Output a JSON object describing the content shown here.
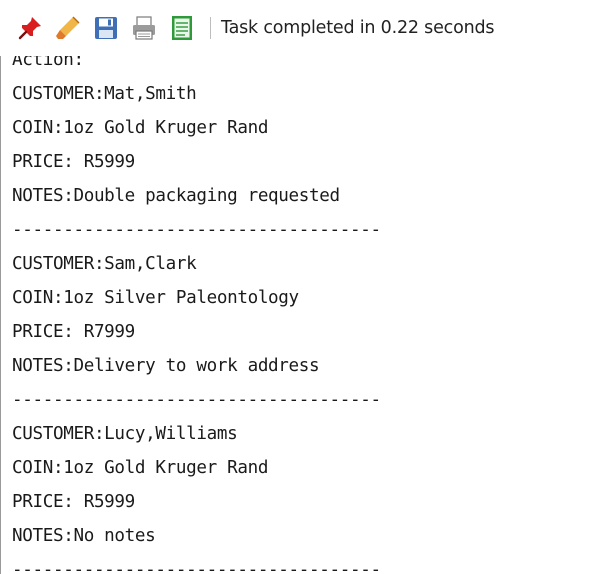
{
  "toolbar": {
    "buttons": [
      {
        "name": "pin-button",
        "icon": "pin-icon"
      },
      {
        "name": "eraser-button",
        "icon": "eraser-icon"
      },
      {
        "name": "save-button",
        "icon": "floppy-disk-icon"
      },
      {
        "name": "print-button",
        "icon": "printer-icon"
      },
      {
        "name": "export-button",
        "icon": "spreadsheet-icon"
      }
    ],
    "status_text": "Task completed in 0.22 seconds"
  },
  "output": {
    "lines": [
      "Action:",
      "CUSTOMER:Mat,Smith",
      "COIN:1oz Gold Kruger Rand",
      "PRICE: R5999",
      "NOTES:Double packaging requested",
      "------------------------------------",
      "CUSTOMER:Sam,Clark",
      "COIN:1oz Silver Paleontology",
      "PRICE: R7999",
      "NOTES:Delivery to work address",
      "------------------------------------",
      "CUSTOMER:Lucy,Williams",
      "COIN:1oz Gold Kruger Rand",
      "PRICE: R5999",
      "NOTES:No notes",
      "------------------------------------"
    ]
  },
  "colors": {
    "pin": "#d81e1e",
    "eraser": "#e79a2c",
    "save": "#3f6fb6",
    "printer": "#7a7a7a",
    "spreadsheet": "#2f9a3a",
    "text": "#1a1a1a"
  }
}
